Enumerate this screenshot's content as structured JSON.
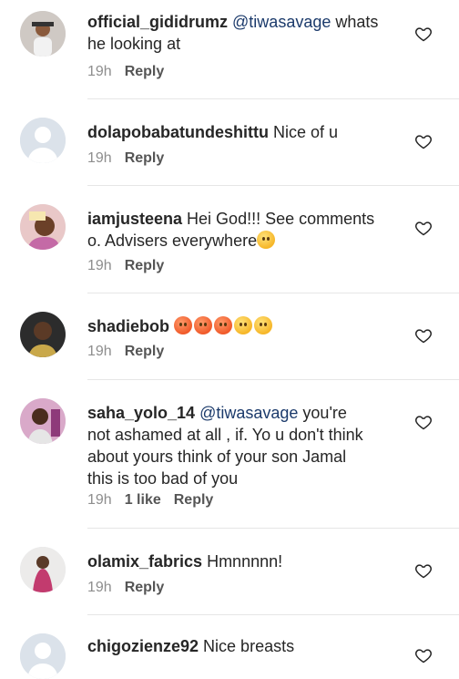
{
  "comments": [
    {
      "username": "official_gididrumz",
      "mention": "@tiwasavage",
      "text_line1": " whats",
      "text_line2": "he looking at",
      "time": "19h",
      "reply_label": "Reply"
    },
    {
      "username": "dolapobabatundeshittu",
      "text": " Nice  of u",
      "time": "19h",
      "reply_label": "Reply"
    },
    {
      "username": "iamjusteena",
      "text_line1": " Hei God!!! See comments",
      "text_line2": "o. Advisers everywhere",
      "emojis": [
        "unamused-face"
      ],
      "time": "19h",
      "reply_label": "Reply"
    },
    {
      "username": "shadiebob",
      "emojis": [
        "flushed-face",
        "flushed-face",
        "flushed-face",
        "pleading-face",
        "pleading-face"
      ],
      "time": "19h",
      "reply_label": "Reply"
    },
    {
      "username": "saha_yolo_14",
      "mention": "@tiwasavage",
      "text_line1": " you're",
      "text_line2": "not ashamed at all , if. Yo u don't think",
      "text_line3": "about yours think of your son Jamal",
      "text_line4": "this is too bad of you",
      "time": "19h",
      "likes": "1 like",
      "reply_label": "Reply"
    },
    {
      "username": "olamix_fabrics",
      "text": " Hmnnnnn!",
      "time": "19h",
      "reply_label": "Reply"
    },
    {
      "username": "chigozienze92",
      "text": " Nice breasts"
    }
  ],
  "icons": {
    "like": "heart-outline-icon",
    "default_avatar": "person-silhouette-icon"
  },
  "colors": {
    "text": "#262626",
    "meta": "#8e8e8e",
    "mention": "#1b3a6b",
    "divider": "#e6e6e6"
  }
}
